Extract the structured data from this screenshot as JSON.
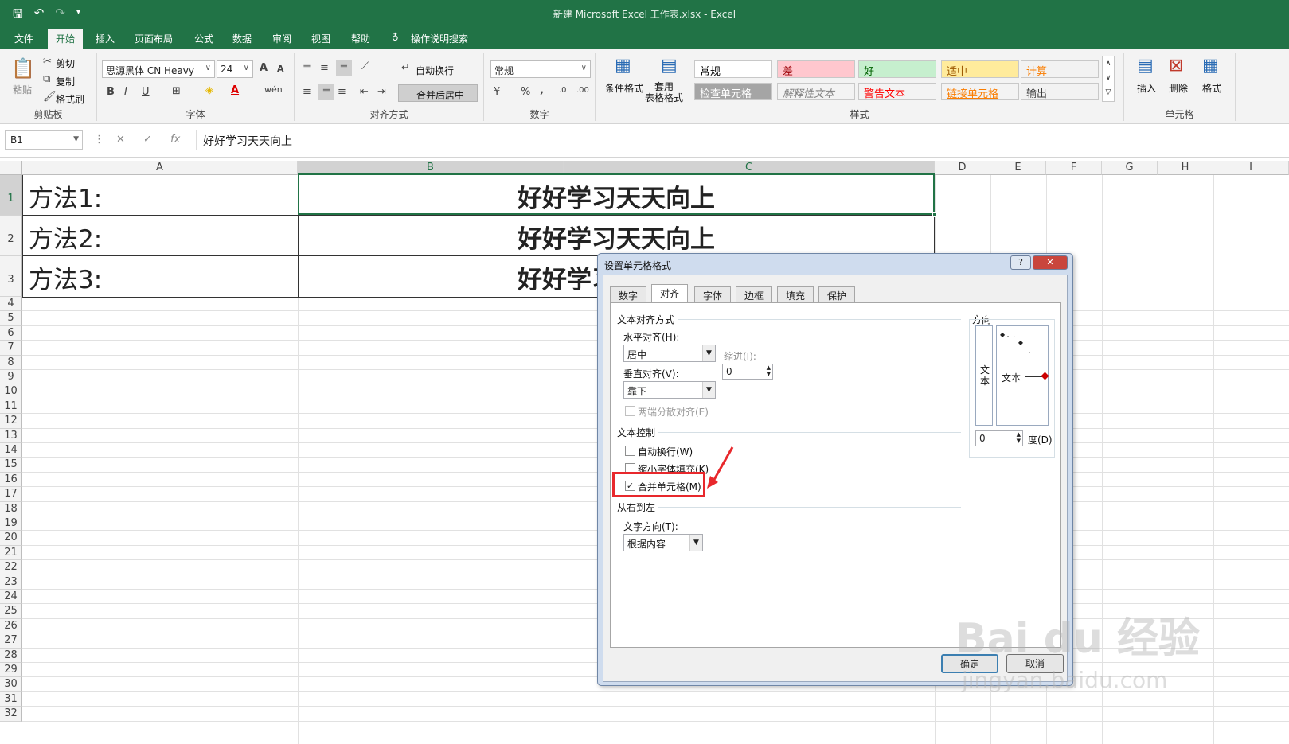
{
  "window": {
    "title": "新建 Microsoft Excel 工作表.xlsx  -  Excel"
  },
  "menu": {
    "items": [
      "文件",
      "开始",
      "插入",
      "页面布局",
      "公式",
      "数据",
      "审阅",
      "视图",
      "帮助"
    ],
    "tell_me": "操作说明搜索"
  },
  "ribbon": {
    "clipboard": {
      "paste": "粘贴",
      "cut": "剪切",
      "copy": "复制",
      "painter": "格式刷",
      "group": "剪贴板"
    },
    "font": {
      "name": "思源黑体 CN Heavy",
      "size": "24",
      "bold": "B",
      "italic": "I",
      "underline": "U",
      "grow": "A",
      "shrink": "A",
      "group": "字体"
    },
    "align": {
      "wrap": "自动换行",
      "merge": "合并后居中",
      "group": "对齐方式"
    },
    "number": {
      "format": "常规",
      "percent": "%",
      "comma": ",",
      "group": "数字"
    },
    "styles": {
      "cond": "条件格式",
      "table": "套用\n表格格式",
      "group": "样式",
      "cells": [
        {
          "t": "常规",
          "bg": "#ffffff",
          "c": "#000000"
        },
        {
          "t": "差",
          "bg": "#ffc7ce",
          "c": "#9c0006"
        },
        {
          "t": "好",
          "bg": "#c6efce",
          "c": "#006100"
        },
        {
          "t": "适中",
          "bg": "#ffeb9c",
          "c": "#9c5700"
        },
        {
          "t": "计算",
          "bg": "#f2f2f2",
          "c": "#fa7d00"
        },
        {
          "t": "检查单元格",
          "bg": "#a5a5a5",
          "c": "#ffffff"
        },
        {
          "t": "解释性文本",
          "bg": "#f3f3f3",
          "c": "#7f7f7f"
        },
        {
          "t": "警告文本",
          "bg": "#f3f3f3",
          "c": "#ff0000"
        },
        {
          "t": "链接单元格",
          "bg": "#f3f3f3",
          "c": "#fa7d00"
        },
        {
          "t": "输出",
          "bg": "#f2f2f2",
          "c": "#3f3f3f"
        }
      ]
    },
    "cells": {
      "insert": "插入",
      "delete": "删除",
      "format": "格式",
      "group": "单元格"
    }
  },
  "formula_bar": {
    "name_box": "B1",
    "fx": "fx",
    "content": "好好学习天天向上"
  },
  "sheet": {
    "columns": [
      "A",
      "B",
      "C",
      "D",
      "E",
      "F",
      "G",
      "H",
      "I"
    ],
    "rows": [
      "1",
      "2",
      "3",
      "4",
      "5",
      "6",
      "7",
      "8",
      "9",
      "10",
      "11",
      "12",
      "13",
      "14",
      "15",
      "16",
      "17",
      "18",
      "19",
      "20",
      "21",
      "22",
      "23",
      "24",
      "25",
      "26",
      "27",
      "28",
      "29",
      "30",
      "31",
      "32"
    ],
    "a": [
      "方法1:",
      "方法2:",
      "方法3:"
    ],
    "b": [
      "好好学习天天向上",
      "好好学习天天向上",
      "好好学习天天向上"
    ]
  },
  "dialog": {
    "title": "设置单元格格式",
    "help": "?",
    "close": "✕",
    "tabs": [
      "数字",
      "对齐",
      "字体",
      "边框",
      "填充",
      "保护"
    ],
    "text_align": "文本对齐方式",
    "horizontal": "水平对齐(H):",
    "horizontal_value": "居中",
    "indent": "缩进(I):",
    "indent_value": "0",
    "vertical": "垂直对齐(V):",
    "vertical_value": "靠下",
    "justify_distributed": "两端分散对齐(E)",
    "text_control": "文本控制",
    "wrap_text": "自动换行(W)",
    "shrink": "缩小字体填充(K)",
    "merge": "合并单元格(M)",
    "merge_checked": "✓",
    "rtl": "从右到左",
    "direction": "文字方向(T):",
    "direction_value": "根据内容",
    "orientation": "方向",
    "orient_vertical": "文\n本",
    "orient_text": "文本",
    "degree_value": "0",
    "degree": "度(D)",
    "ok": "确定",
    "cancel": "取消"
  },
  "watermark": {
    "brand": "Bai du 经验",
    "url": "jingyan.baidu.com"
  }
}
